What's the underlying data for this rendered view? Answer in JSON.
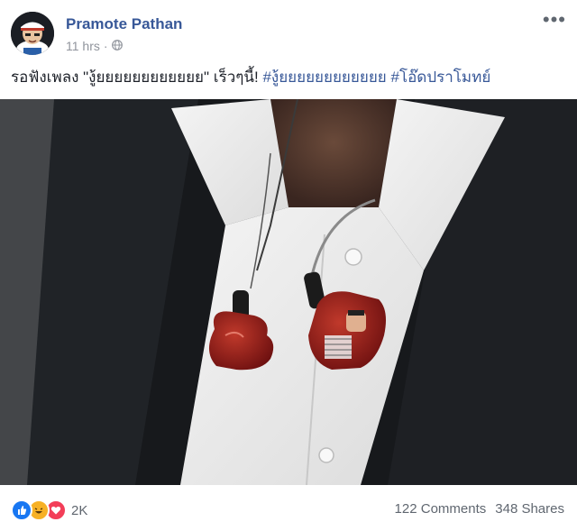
{
  "post": {
    "author": "Pramote Pathan",
    "time": "11 hrs",
    "visibility_icon": "globe-icon",
    "more_label": "•••",
    "text_plain": "รอฟังเพลง \"งู้ยยยยยยยยยยยย\" เร็วๆนี้! ",
    "hashtags": [
      "#งู้ยยยยยยยยยยยย",
      "#โอ๊ดปราโมทย์"
    ]
  },
  "footer": {
    "reactions": [
      "like-icon",
      "haha-icon",
      "love-icon"
    ],
    "reaction_count": "2K",
    "comments": "122 Comments",
    "shares": "348 Shares"
  },
  "colors": {
    "author": "#385898",
    "hashtag": "#385898",
    "meta": "#90949c",
    "like": "#1877f2",
    "haha": "#f7b125",
    "love": "#f33e58"
  }
}
